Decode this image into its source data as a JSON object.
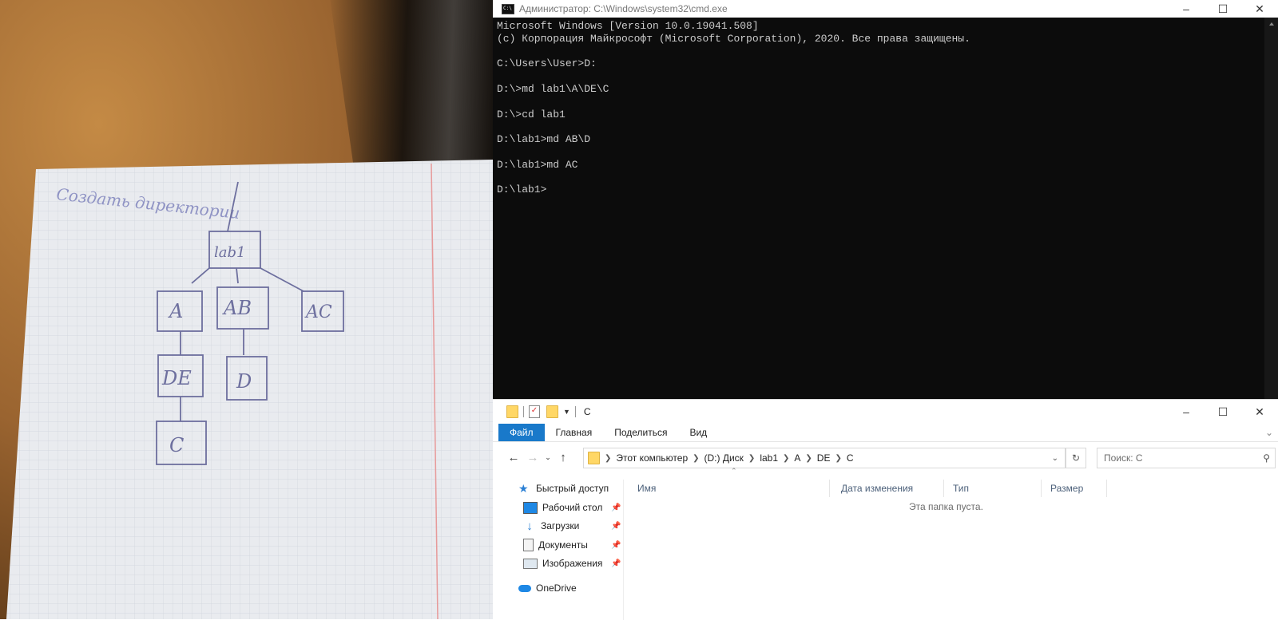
{
  "photo": {
    "handwriting_title": "Создать директории",
    "tree": {
      "root": "lab1",
      "level1": [
        "A",
        "AB",
        "AC"
      ],
      "level2": [
        "DE",
        "D"
      ],
      "level3": [
        "C"
      ]
    }
  },
  "cmd": {
    "title": "Администратор: C:\\Windows\\system32\\cmd.exe",
    "lines": [
      "Microsoft Windows [Version 10.0.19041.508]",
      "(c) Корпорация Майкрософт (Microsoft Corporation), 2020. Все права защищены.",
      "",
      "C:\\Users\\User>D:",
      "",
      "D:\\>md lab1\\A\\DE\\C",
      "",
      "D:\\>cd lab1",
      "",
      "D:\\lab1>md AB\\D",
      "",
      "D:\\lab1>md AC",
      "",
      "D:\\lab1>"
    ],
    "colors": {
      "background": "#0c0c0c",
      "text": "#cccccc"
    }
  },
  "explorer": {
    "title": "C",
    "ribbon": {
      "tabs": [
        "Файл",
        "Главная",
        "Поделиться",
        "Вид"
      ],
      "active_tab": "Файл"
    },
    "address": {
      "crumbs": [
        "Этот компьютер",
        "(D:) Диск",
        "lab1",
        "A",
        "DE",
        "C"
      ]
    },
    "search": {
      "placeholder": "Поиск: C"
    },
    "nav": {
      "quick_access": "Быстрый доступ",
      "items": [
        {
          "label": "Рабочий стол",
          "icon": "desktop-icon"
        },
        {
          "label": "Загрузки",
          "icon": "downloads-icon"
        },
        {
          "label": "Документы",
          "icon": "documents-icon"
        },
        {
          "label": "Изображения",
          "icon": "pictures-icon"
        }
      ],
      "onedrive": "OneDrive"
    },
    "columns": [
      "Имя",
      "Дата изменения",
      "Тип",
      "Размер"
    ],
    "empty_message": "Эта папка пуста.",
    "colors": {
      "accent": "#1979ca",
      "folder": "#ffd766"
    }
  }
}
